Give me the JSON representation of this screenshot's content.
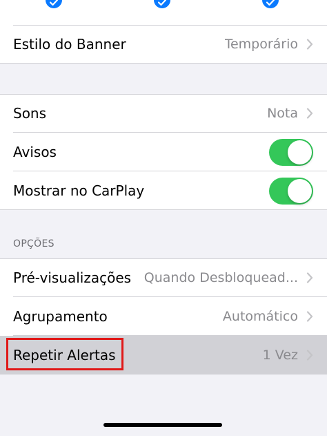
{
  "top_checks": [
    "checkmark-icon",
    "checkmark-icon",
    "checkmark-icon"
  ],
  "banner": {
    "label": "Estilo do Banner",
    "value": "Temporário"
  },
  "sounds": {
    "label": "Sons",
    "value": "Nota"
  },
  "alerts": {
    "label": "Avisos",
    "on": true
  },
  "carplay": {
    "label": "Mostrar no CarPlay",
    "on": true
  },
  "options": {
    "header": "OPÇÕES",
    "previews": {
      "label": "Pré-visualizações",
      "value": "Quando Desbloquead..."
    },
    "grouping": {
      "label": "Agrupamento",
      "value": "Automático"
    },
    "repeat": {
      "label": "Repetir Alertas",
      "value": "1 Vez"
    }
  },
  "colors": {
    "accent": "#0a7aff",
    "toggle_on": "#34c759",
    "highlight_box": "#e01818",
    "secondary_text": "#8a8a8e"
  }
}
